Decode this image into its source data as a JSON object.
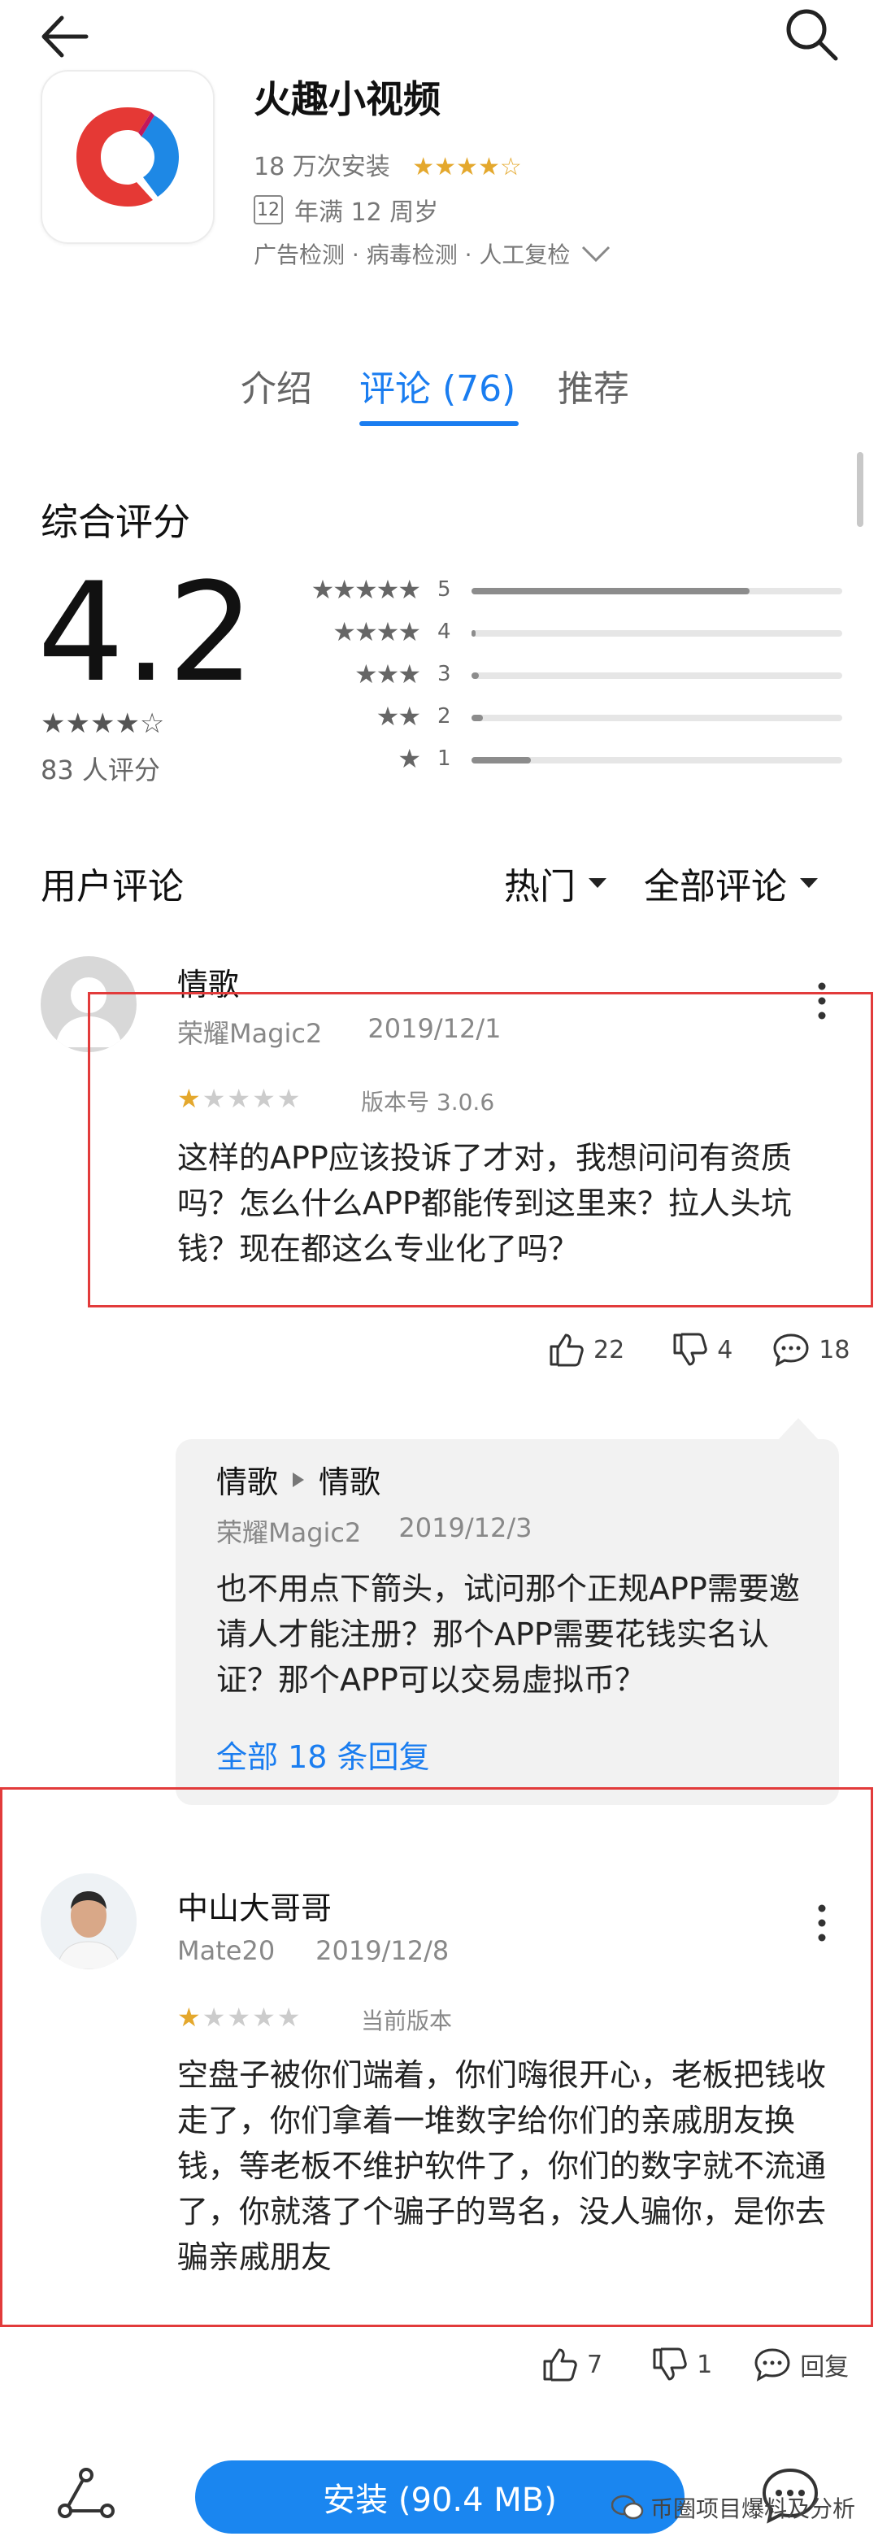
{
  "header": {
    "back_icon": "arrow-left-icon",
    "search_icon": "search-icon"
  },
  "app": {
    "name": "火趣小视频",
    "installs": "18 万次安装",
    "rating_stars": "★★★★☆",
    "age_badge": "12",
    "age_text": "年满 12 周岁",
    "security": "广告检测 · 病毒检测 · 人工复检",
    "brand_colors": [
      "#e53935",
      "#1e88e5"
    ]
  },
  "tabs": [
    {
      "label": "介绍",
      "active": false
    },
    {
      "label": "评论 (76)",
      "active": true
    },
    {
      "label": "推荐",
      "active": false
    }
  ],
  "summary": {
    "title": "综合评分",
    "score": "4.2",
    "stars": "★★★★☆",
    "count": "83 人评分",
    "distribution": [
      {
        "label": "5",
        "stars": "★★★★★",
        "fraction": 0.75
      },
      {
        "label": "4",
        "stars": "★★★★",
        "fraction": 0.01
      },
      {
        "label": "3",
        "stars": "★★★",
        "fraction": 0.02
      },
      {
        "label": "2",
        "stars": "★★",
        "fraction": 0.03
      },
      {
        "label": "1",
        "stars": "★",
        "fraction": 0.16
      }
    ]
  },
  "reviews_header": {
    "title": "用户评论",
    "sort": "热门",
    "filter": "全部评论"
  },
  "reviews": [
    {
      "name": "情歌",
      "device": "荣耀Magic2",
      "date": "2019/12/1",
      "rating": 1,
      "stars_on": "★",
      "stars_off": "★★★★",
      "version": "版本号 3.0.6",
      "text": "这样的APP应该投诉了才对，我想问问有资质吗？怎么什么APP都能传到这里来？拉人头坑钱？现在都这么专业化了吗？",
      "likes": "22",
      "dislikes": "4",
      "comments": "18"
    },
    {
      "name": "中山大哥哥",
      "device": "Mate20",
      "date": "2019/12/8",
      "rating": 1,
      "stars_on": "★",
      "stars_off": "★★★★",
      "version": "当前版本",
      "text": "空盘子被你们端着，你们嗨很开心，老板把钱收走了，你们拿着一堆数字给你们的亲戚朋友换钱，等老板不维护软件了，你们的数字就不流通了，你就落了个骗子的骂名，没人骗你，是你去骗亲戚朋友",
      "likes": "7",
      "dislikes": "1",
      "reply_label": "回复"
    }
  ],
  "reply": {
    "from": "情歌",
    "to": "情歌",
    "device": "荣耀Magic2",
    "date": "2019/12/3",
    "text": "也不用点下箭头，试问那个正规APP需要邀请人才能注册？那个APP需要花钱实名认证？那个APP可以交易虚拟币？",
    "all_replies": "全部 18 条回复"
  },
  "bottom": {
    "share_icon": "share-icon",
    "install_label": "安装 (90.4 MB)",
    "comment_icon": "comment-icon",
    "watermark": "币圈项目爆料及分析"
  },
  "colors": {
    "accent": "#1a7df0",
    "star": "#e4a82d",
    "highlight_box": "#e23b3b"
  }
}
